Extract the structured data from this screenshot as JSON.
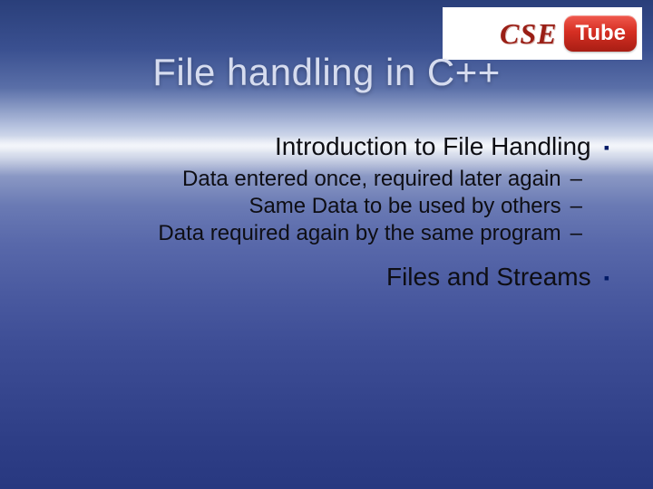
{
  "logo": {
    "cse": "CSE",
    "tube": "Tube"
  },
  "title": "File handling in C++",
  "sections": [
    {
      "heading": "Introduction to File Handling",
      "items": [
        "Data entered once, required later again",
        "Same Data to be used by others",
        "Data required again by the same program"
      ]
    },
    {
      "heading": "Files and Streams",
      "items": []
    }
  ],
  "bullets": {
    "square": "▪",
    "dash": "–"
  }
}
